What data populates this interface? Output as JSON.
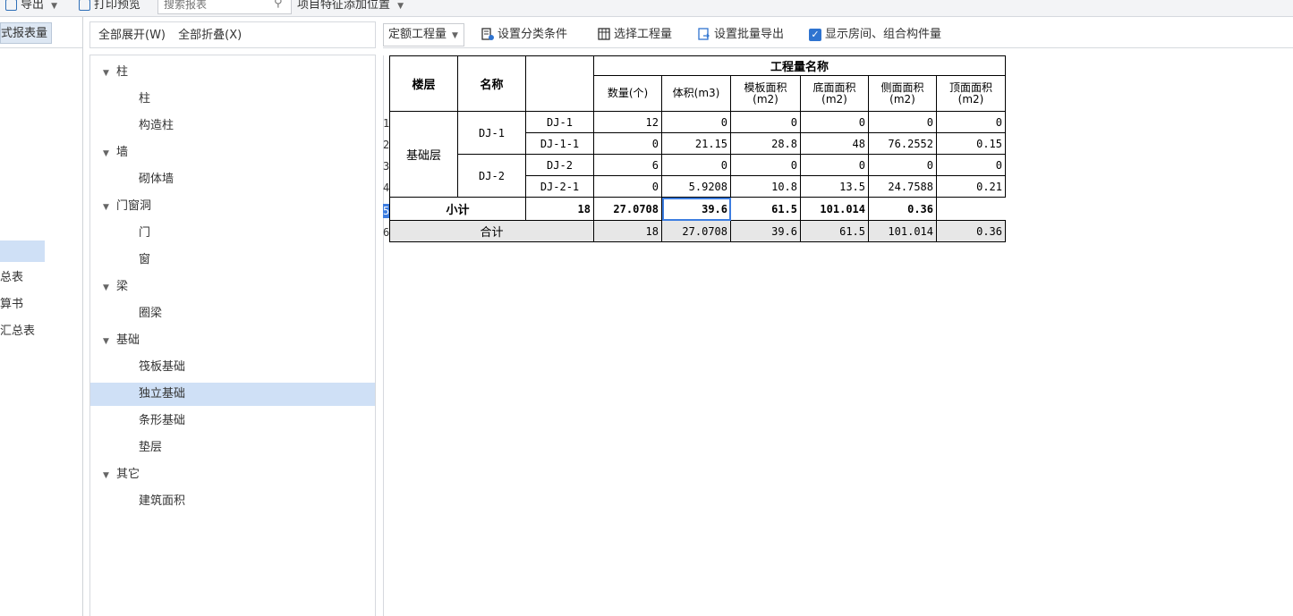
{
  "topbar": {
    "export_label": "导出",
    "print_label": "打印预览",
    "search_placeholder": "搜索报表",
    "feature_label": "项目特征添加位置"
  },
  "leftnav": {
    "header": "式报表量",
    "items": [
      {
        "label": "",
        "selected": true
      },
      {
        "label": "总表"
      },
      {
        "label": "算书"
      },
      {
        "label": "汇总表"
      }
    ]
  },
  "tree_header": {
    "expand_all": "全部展开(W)",
    "collapse_all": "全部折叠(X)"
  },
  "tree": [
    {
      "label": "柱",
      "children": [
        "柱",
        "构造柱"
      ]
    },
    {
      "label": "墙",
      "children": [
        "砌体墙"
      ]
    },
    {
      "label": "门窗洞",
      "children": [
        "门",
        "窗"
      ]
    },
    {
      "label": "梁",
      "children": [
        "圈梁"
      ]
    },
    {
      "label": "基础",
      "children": [
        "筏板基础",
        "独立基础",
        "条形基础",
        "垫层"
      ],
      "selected_child": "独立基础"
    },
    {
      "label": "其它",
      "children": [
        "建筑面积"
      ]
    }
  ],
  "toolbar": {
    "quota_dropdown": "定额工程量",
    "set_classify": "设置分类条件",
    "select_quantity": "选择工程量",
    "batch_export": "设置批量导出",
    "show_rooms": "显示房间、组合构件量",
    "show_rooms_checked": true
  },
  "report": {
    "header": {
      "floor": "楼层",
      "name": "名称",
      "group": "工程量名称",
      "cols": [
        "数量(个)",
        "体积(m3)",
        "模板面积(m2)",
        "底面面积(m2)",
        "侧面面积(m2)",
        "顶面面积(m2)"
      ]
    },
    "floor": "基础层",
    "groups": [
      {
        "name": "DJ-1",
        "rows": [
          {
            "sub": "DJ-1",
            "values": [
              "12",
              "0",
              "0",
              "0",
              "0",
              "0"
            ]
          },
          {
            "sub": "DJ-1-1",
            "values": [
              "0",
              "21.15",
              "28.8",
              "48",
              "76.2552",
              "0.15"
            ]
          }
        ]
      },
      {
        "name": "DJ-2",
        "rows": [
          {
            "sub": "DJ-2",
            "values": [
              "6",
              "0",
              "0",
              "0",
              "0",
              "0"
            ]
          },
          {
            "sub": "DJ-2-1",
            "values": [
              "0",
              "5.9208",
              "10.8",
              "13.5",
              "24.7588",
              "0.21"
            ]
          }
        ]
      }
    ],
    "subtotal": {
      "label": "小计",
      "values": [
        "18",
        "27.0708",
        "39.6",
        "61.5",
        "101.014",
        "0.36"
      ]
    },
    "total": {
      "label": "合计",
      "values": [
        "18",
        "27.0708",
        "39.6",
        "61.5",
        "101.014",
        "0.36"
      ]
    },
    "row_numbers": [
      "1",
      "2",
      "3",
      "4",
      "5",
      "6"
    ]
  }
}
